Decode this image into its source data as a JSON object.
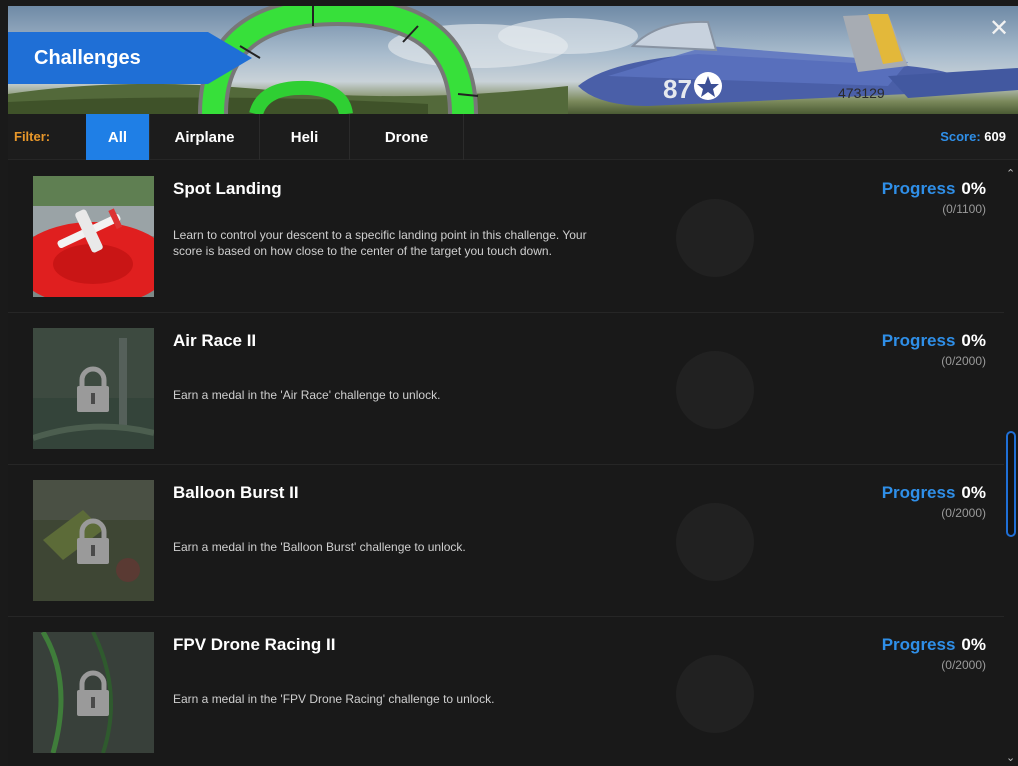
{
  "window": {
    "title": "Challenges",
    "close_icon": "close-icon",
    "close_glyph": "✕"
  },
  "filter": {
    "label": "Filter:",
    "tabs": [
      {
        "label": "All",
        "active": true
      },
      {
        "label": "Airplane",
        "active": false
      },
      {
        "label": "Heli",
        "active": false
      },
      {
        "label": "Drone",
        "active": false
      }
    ]
  },
  "score": {
    "label": "Score:",
    "value": "609"
  },
  "challenges": [
    {
      "title": "Spot Landing",
      "description": "Learn to control your descent to a specific landing point in this challenge. Your score is based on how close to the center of the target you touch down.",
      "progress_label": "Progress",
      "progress_percent": "0%",
      "progress_count": "(0/1100)",
      "locked": false
    },
    {
      "title": "Air Race II",
      "description": "Earn a medal in the 'Air Race' challenge to unlock.",
      "progress_label": "Progress",
      "progress_percent": "0%",
      "progress_count": "(0/2000)",
      "locked": true
    },
    {
      "title": "Balloon Burst II",
      "description": "Earn a medal in the 'Balloon Burst' challenge to unlock.",
      "progress_label": "Progress",
      "progress_percent": "0%",
      "progress_count": "(0/2000)",
      "locked": true
    },
    {
      "title": "FPV Drone Racing II",
      "description": "Earn a medal in the 'FPV Drone Racing' challenge to unlock.",
      "progress_label": "Progress",
      "progress_percent": "0%",
      "progress_count": "(0/2000)",
      "locked": true
    }
  ],
  "colors": {
    "accent_blue": "#1f7fe6",
    "filter_orange": "#e8972a",
    "progress_blue": "#2f8fe8"
  }
}
